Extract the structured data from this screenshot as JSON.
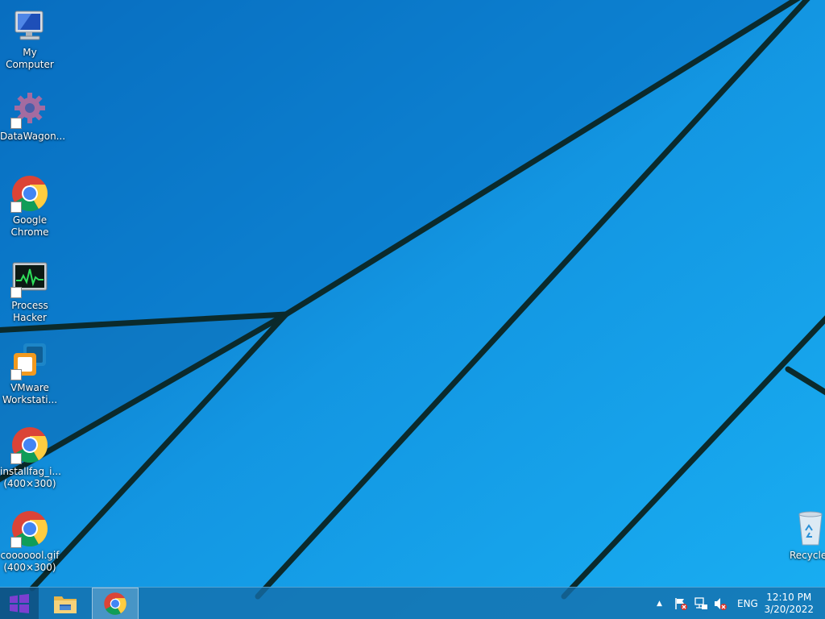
{
  "desktop": {
    "icons": [
      {
        "label": "My\nComputer",
        "icon": "computer-icon"
      },
      {
        "label": "DataWagon...",
        "icon": "gear-icon"
      },
      {
        "label": "Google\nChrome",
        "icon": "chrome-icon"
      },
      {
        "label": "Process\nHacker",
        "icon": "monitor-graph-icon"
      },
      {
        "label": "VMware\nWorkstati...",
        "icon": "vmware-icon"
      },
      {
        "label": "installfag_i...\n(400×300)",
        "icon": "chrome-icon"
      },
      {
        "label": "cooooool.gif\n(400×300)",
        "icon": "chrome-icon"
      }
    ],
    "recycle_bin": {
      "label": "Recycle",
      "icon": "recycle-bin-icon"
    }
  },
  "taskbar": {
    "start": {
      "icon": "windows-logo-icon"
    },
    "pinned": [
      {
        "name": "File Explorer",
        "icon": "folder-icon"
      },
      {
        "name": "Google Chrome",
        "icon": "chrome-icon",
        "active": true
      }
    ],
    "tray": {
      "show_hidden": "▲",
      "icons": [
        "action-center-flag-icon",
        "network-icon",
        "volume-muted-icon"
      ],
      "language": "ENG",
      "time": "12:10 PM",
      "date": "3/20/2022"
    }
  },
  "colors": {
    "wallpaper_blue": "#0f8fe0",
    "wallpaper_line": "#0b2a2c",
    "taskbar": "#146eaa"
  }
}
